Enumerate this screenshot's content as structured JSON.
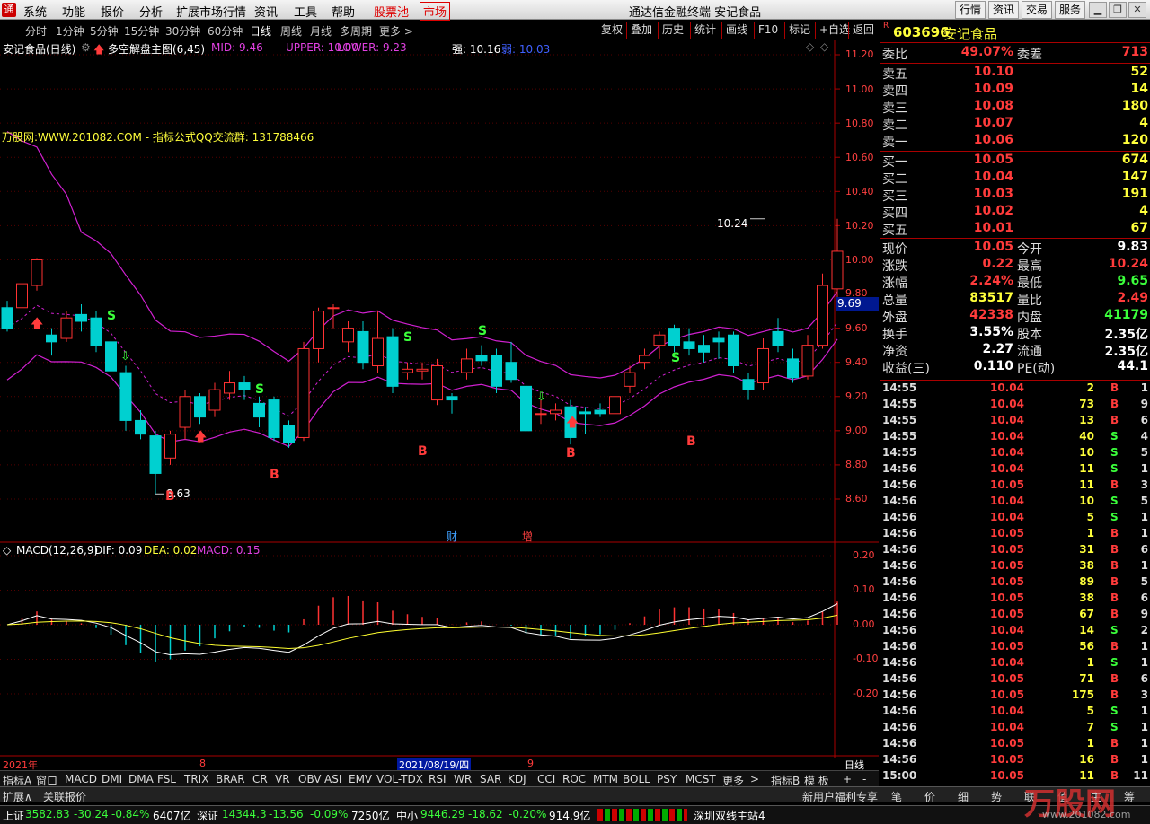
{
  "menubar": {
    "items": [
      "系统",
      "功能",
      "报价",
      "分析",
      "扩展市场行情",
      "资讯",
      "工具",
      "帮助"
    ],
    "stock_pool": "股票池",
    "market": "市场",
    "title": "通达信金融终端 安记食品",
    "buttons": [
      "行情",
      "资讯",
      "交易",
      "服务"
    ]
  },
  "periods": {
    "items": [
      "分时",
      "1分钟",
      "5分钟",
      "15分钟",
      "30分钟",
      "60分钟",
      "日线",
      "周线",
      "月线",
      "多周期",
      "更多 >"
    ],
    "active": "日线",
    "tools": [
      "复权",
      "叠加",
      "历史",
      "统计",
      "画线",
      "F10",
      "标记",
      "+自选",
      "返回"
    ]
  },
  "chart": {
    "stock_title": "安记食品(日线)",
    "indicator_name": "多空解盘主图(6,45)",
    "mid_label": "MID: 9.46",
    "upper_label": "UPPER: 10.00",
    "lower_label": "LOWER: 9.23",
    "strong_label": "强: 10.16",
    "weak_label": "弱: 10.03",
    "promo": "万股网:WWW.201082.COM - 指标公式QQ交流群: 131788466",
    "price_axis": [
      "11.20",
      "11.00",
      "10.80",
      "10.60",
      "10.40",
      "10.20",
      "10.00",
      "9.80",
      "9.60",
      "9.40",
      "9.20",
      "9.00",
      "8.80",
      "8.60"
    ],
    "current_price_tag": "9.69",
    "high_label": "10.24",
    "low_label": "8.63",
    "signal_s": "S",
    "signal_b": "B",
    "event_cai": "财",
    "event_zeng": "增",
    "chart_data": {
      "type": "candlestick",
      "high": 10.24,
      "low": 8.63,
      "price_ylim": [
        8.5,
        11.25
      ],
      "macd_ylim": [
        -0.3,
        0.25
      ],
      "candles": [
        [
          9.72,
          9.6,
          9.76,
          9.58
        ],
        [
          9.72,
          9.86,
          9.9,
          9.68
        ],
        [
          9.85,
          10.0,
          10.01,
          9.82
        ],
        [
          9.56,
          9.52,
          9.6,
          9.44
        ],
        [
          9.54,
          9.66,
          9.7,
          9.52
        ],
        [
          9.68,
          9.64,
          9.74,
          9.58
        ],
        [
          9.66,
          9.5,
          9.7,
          9.46
        ],
        [
          9.52,
          9.35,
          9.56,
          9.3
        ],
        [
          9.34,
          9.06,
          9.38,
          9.0
        ],
        [
          9.06,
          8.98,
          9.12,
          8.95
        ],
        [
          8.97,
          8.75,
          9.0,
          8.63
        ],
        [
          8.84,
          8.98,
          9.0,
          8.8
        ],
        [
          9.02,
          9.2,
          9.24,
          8.95
        ],
        [
          9.2,
          9.08,
          9.22,
          9.04
        ],
        [
          9.12,
          9.24,
          9.28,
          9.08
        ],
        [
          9.22,
          9.28,
          9.35,
          9.18
        ],
        [
          9.28,
          9.24,
          9.32,
          9.18
        ],
        [
          9.16,
          9.08,
          9.2,
          9.02
        ],
        [
          9.18,
          8.96,
          9.2,
          8.94
        ],
        [
          9.03,
          8.93,
          9.06,
          8.9
        ],
        [
          8.96,
          9.48,
          9.52,
          8.94
        ],
        [
          9.48,
          9.7,
          9.72,
          9.4
        ],
        [
          9.72,
          9.72,
          9.74,
          9.6
        ],
        [
          9.52,
          9.6,
          9.64,
          9.46
        ],
        [
          9.58,
          9.4,
          9.64,
          9.36
        ],
        [
          9.38,
          9.54,
          9.7,
          9.34
        ],
        [
          9.55,
          9.26,
          9.6,
          9.22
        ],
        [
          9.34,
          9.36,
          9.4,
          9.3
        ],
        [
          9.35,
          9.36,
          9.4,
          9.3
        ],
        [
          9.18,
          9.38,
          9.42,
          9.15
        ],
        [
          9.2,
          9.18,
          9.22,
          9.1
        ],
        [
          9.34,
          9.42,
          9.48,
          9.3
        ],
        [
          9.44,
          9.41,
          9.5,
          9.38
        ],
        [
          9.44,
          9.26,
          9.48,
          9.22
        ],
        [
          9.4,
          9.3,
          9.52,
          9.28
        ],
        [
          9.26,
          9.0,
          9.3,
          8.94
        ],
        [
          9.1,
          9.1,
          9.18,
          9.04
        ],
        [
          9.1,
          9.12,
          9.16,
          9.06
        ],
        [
          9.14,
          8.96,
          9.18,
          8.92
        ],
        [
          9.11,
          9.1,
          9.14,
          8.98
        ],
        [
          9.12,
          9.1,
          9.16,
          9.08
        ],
        [
          9.1,
          9.2,
          9.24,
          9.06
        ],
        [
          9.26,
          9.34,
          9.38,
          9.22
        ],
        [
          9.4,
          9.44,
          9.48,
          9.36
        ],
        [
          9.5,
          9.56,
          9.58,
          9.42
        ],
        [
          9.6,
          9.5,
          9.62,
          9.46
        ],
        [
          9.52,
          9.48,
          9.6,
          9.44
        ],
        [
          9.5,
          9.46,
          9.56,
          9.4
        ],
        [
          9.54,
          9.52,
          9.58,
          9.42
        ],
        [
          9.56,
          9.38,
          9.58,
          9.34
        ],
        [
          9.3,
          9.24,
          9.34,
          9.18
        ],
        [
          9.28,
          9.48,
          9.54,
          9.24
        ],
        [
          9.58,
          9.5,
          9.66,
          9.46
        ],
        [
          9.42,
          9.31,
          9.48,
          9.28
        ],
        [
          9.32,
          9.5,
          9.56,
          9.3
        ],
        [
          9.5,
          9.85,
          9.92,
          9.48
        ],
        [
          9.83,
          10.05,
          10.24,
          9.7
        ]
      ]
    }
  },
  "macd": {
    "name": "MACD(12,26,9)",
    "dif": "DIF: 0.09",
    "dea": "DEA: 0.02",
    "macd": "MACD: 0.15",
    "axis": [
      "0.20",
      "0.10",
      "0.00",
      "-0.10",
      "-0.20"
    ]
  },
  "xaxis": {
    "year": "2021年",
    "m8": "8",
    "date": "2021/08/19/四",
    "m9": "9",
    "period": "日线"
  },
  "bottom_tabs": [
    "指标A",
    "窗口",
    "MACD",
    "DMI",
    "DMA",
    "FSL",
    "TRIX",
    "BRAR",
    "CR",
    "VR",
    "OBV",
    "ASI",
    "EMV",
    "VOL-TDX",
    "RSI",
    "WR",
    "SAR",
    "KDJ",
    "CCI",
    "ROC",
    "MTM",
    "BOLL",
    "PSY",
    "MCST",
    "更多",
    ">",
    "指标B",
    "模 板",
    "+",
    "-"
  ],
  "statusbar": {
    "left1": "扩展∧",
    "left2": "关联报价",
    "right": "新用户福利专享",
    "tabs": [
      "笔",
      "价",
      "细",
      "势",
      "联",
      "值",
      "主",
      "筹"
    ]
  },
  "quote": {
    "code": "603696",
    "name": "安记食品",
    "weibi_label": "委比",
    "weibi": "49.07%",
    "weicha_label": "委差",
    "weicha": "713",
    "asks": [
      {
        "label": "卖五",
        "price": "10.10",
        "vol": "52"
      },
      {
        "label": "卖四",
        "price": "10.09",
        "vol": "14"
      },
      {
        "label": "卖三",
        "price": "10.08",
        "vol": "180"
      },
      {
        "label": "卖二",
        "price": "10.07",
        "vol": "4"
      },
      {
        "label": "卖一",
        "price": "10.06",
        "vol": "120"
      }
    ],
    "bids": [
      {
        "label": "买一",
        "price": "10.05",
        "vol": "674"
      },
      {
        "label": "买二",
        "price": "10.04",
        "vol": "147"
      },
      {
        "label": "买三",
        "price": "10.03",
        "vol": "191"
      },
      {
        "label": "买四",
        "price": "10.02",
        "vol": "4"
      },
      {
        "label": "买五",
        "price": "10.01",
        "vol": "67"
      }
    ],
    "stats": [
      {
        "l": "现价",
        "v": "10.05",
        "vc": "red",
        "l2": "今开",
        "v2": "9.83",
        "v2c": "white"
      },
      {
        "l": "涨跌",
        "v": "0.22",
        "vc": "red",
        "l2": "最高",
        "v2": "10.24",
        "v2c": "red"
      },
      {
        "l": "涨幅",
        "v": "2.24%",
        "vc": "red",
        "l2": "最低",
        "v2": "9.65",
        "v2c": "green"
      },
      {
        "l": "总量",
        "v": "83517",
        "vc": "yellow",
        "l2": "量比",
        "v2": "2.49",
        "v2c": "red"
      },
      {
        "l": "外盘",
        "v": "42338",
        "vc": "red",
        "l2": "内盘",
        "v2": "41179",
        "v2c": "green"
      },
      {
        "l": "换手",
        "v": "3.55%",
        "vc": "white",
        "l2": "股本",
        "v2": "2.35亿",
        "v2c": "white"
      },
      {
        "l": "净资",
        "v": "2.27",
        "vc": "white",
        "l2": "流通",
        "v2": "2.35亿",
        "v2c": "white"
      },
      {
        "l": "收益(三)",
        "v": "0.110",
        "vc": "white",
        "l2": "PE(动)",
        "v2": "44.1",
        "v2c": "white"
      }
    ],
    "ticks": [
      [
        "14:55",
        "10.04",
        "2",
        "B",
        "1"
      ],
      [
        "14:55",
        "10.04",
        "73",
        "B",
        "9"
      ],
      [
        "14:55",
        "10.04",
        "13",
        "B",
        "6"
      ],
      [
        "14:55",
        "10.04",
        "40",
        "S",
        "4"
      ],
      [
        "14:55",
        "10.04",
        "10",
        "S",
        "5"
      ],
      [
        "14:56",
        "10.04",
        "11",
        "S",
        "1"
      ],
      [
        "14:56",
        "10.05",
        "11",
        "B",
        "3"
      ],
      [
        "14:56",
        "10.04",
        "10",
        "S",
        "5"
      ],
      [
        "14:56",
        "10.04",
        "5",
        "S",
        "1"
      ],
      [
        "14:56",
        "10.05",
        "1",
        "B",
        "1"
      ],
      [
        "14:56",
        "10.05",
        "31",
        "B",
        "6"
      ],
      [
        "14:56",
        "10.05",
        "38",
        "B",
        "1"
      ],
      [
        "14:56",
        "10.05",
        "89",
        "B",
        "5"
      ],
      [
        "14:56",
        "10.05",
        "38",
        "B",
        "6"
      ],
      [
        "14:56",
        "10.05",
        "67",
        "B",
        "9"
      ],
      [
        "14:56",
        "10.04",
        "14",
        "S",
        "2"
      ],
      [
        "14:56",
        "10.05",
        "56",
        "B",
        "1"
      ],
      [
        "14:56",
        "10.04",
        "1",
        "S",
        "1"
      ],
      [
        "14:56",
        "10.05",
        "71",
        "B",
        "6"
      ],
      [
        "14:56",
        "10.05",
        "175",
        "B",
        "3"
      ],
      [
        "14:56",
        "10.04",
        "5",
        "S",
        "1"
      ],
      [
        "14:56",
        "10.04",
        "7",
        "S",
        "1"
      ],
      [
        "14:56",
        "10.05",
        "1",
        "B",
        "1"
      ],
      [
        "14:56",
        "10.05",
        "16",
        "B",
        "1"
      ],
      [
        "15:00",
        "10.05",
        "11",
        "B",
        "11"
      ]
    ]
  },
  "index": [
    {
      "name": "上证",
      "val": "3582.83",
      "chg": "-30.24",
      "pct": "-0.84%",
      "amt": "6407亿"
    },
    {
      "name": "深证",
      "val": "14344.3",
      "chg": "-13.56",
      "pct": "-0.09%",
      "amt": "7250亿"
    },
    {
      "name": "中小",
      "val": "9446.29",
      "chg": "-18.62",
      "pct": "-0.20%",
      "amt": "914.9亿"
    }
  ],
  "server": "深圳双线主站4",
  "watermark": "万股网",
  "watermark_url": "www.201082.com"
}
